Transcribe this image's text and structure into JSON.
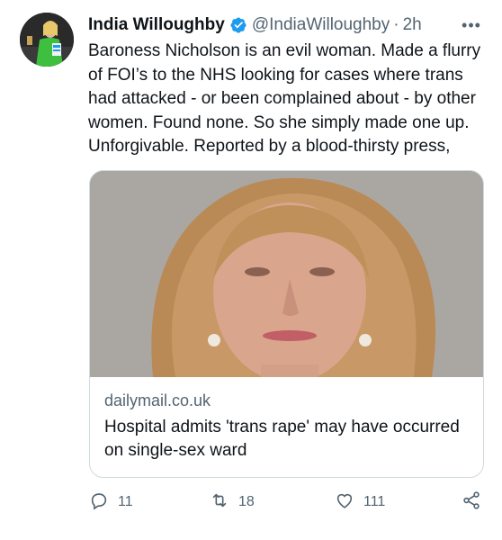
{
  "tweet": {
    "author_name": "India Willoughby",
    "handle": "@IndiaWilloughby",
    "separator": "·",
    "time": "2h",
    "more": "•••",
    "text": "Baroness Nicholson is an evil woman. Made a flurry of FOI’s to the NHS looking for cases where trans had attacked - or been complained about - by other women. Found none. So she simply made one up. Unforgivable. Reported by a blood-thirsty press,"
  },
  "card": {
    "domain": "dailymail.co.uk",
    "headline": "Hospital admits 'trans rape' may have occurred on single-sex ward"
  },
  "actions": {
    "reply_count": "11",
    "retweet_count": "18",
    "like_count": "111"
  },
  "colors": {
    "verified_blue": "#1d9bf0",
    "secondary_text": "#536471",
    "border": "#cfd9de"
  },
  "icons": [
    "verified-badge-icon",
    "more-icon",
    "reply-icon",
    "retweet-icon",
    "like-icon",
    "share-icon"
  ]
}
